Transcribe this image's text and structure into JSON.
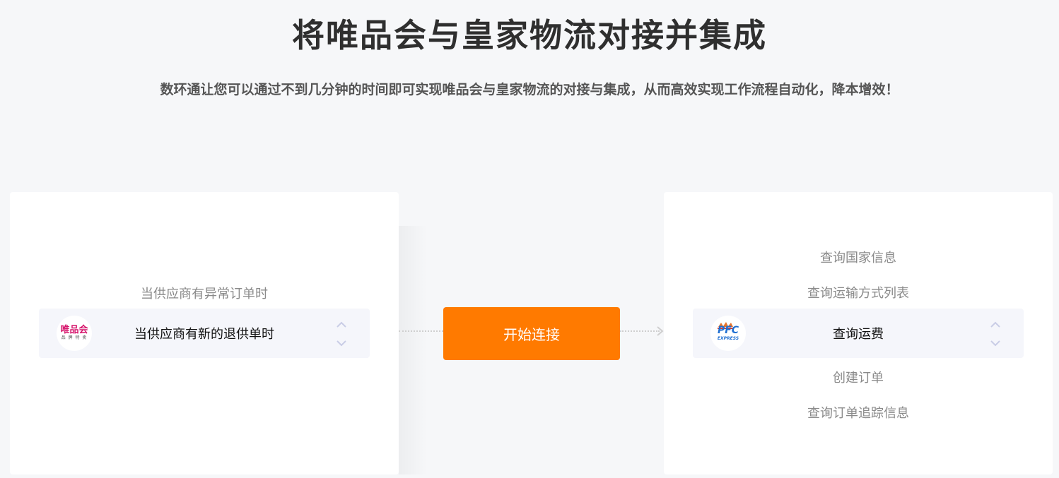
{
  "header": {
    "title": "将唯品会与皇家物流对接并集成",
    "subtitle": "数环通让您可以通过不到几分钟的时间即可实现唯品会与皇家物流的对接与集成，从而高效实现工作流程自动化，降本增效！"
  },
  "left_panel": {
    "app_logo": {
      "main": "唯品会",
      "sub": "品 牌 特 卖",
      "color": "#d6156c"
    },
    "options_above": [
      "当供应商有异常订单时"
    ],
    "selected": "当供应商有新的退供单时",
    "options_below": []
  },
  "connect_button": {
    "label": "开始连接",
    "color": "#ff7a00"
  },
  "right_panel": {
    "app_logo": {
      "main": "PFC",
      "sub": "EXPRESS",
      "color": "#1f6fd1"
    },
    "options_above": [
      "查询国家信息",
      "查询运输方式列表"
    ],
    "selected": "查询运费",
    "options_below": [
      "创建订单",
      "查询订单追踪信息"
    ]
  }
}
